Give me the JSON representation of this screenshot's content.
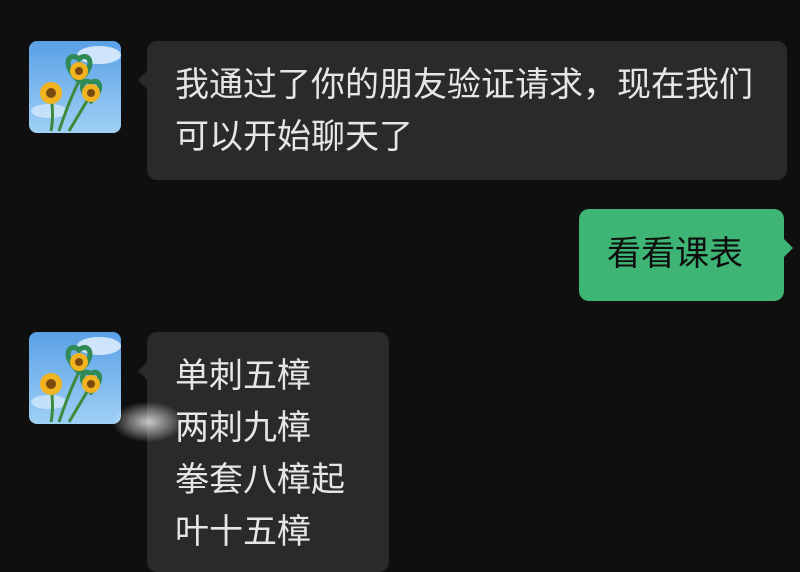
{
  "colors": {
    "background": "#0f0f0f",
    "incoming_bubble": "#2a2a2a",
    "outgoing_bubble": "#3eb575",
    "incoming_text": "#e6e6e6",
    "outgoing_text": "#0e0e0e"
  },
  "messages": [
    {
      "direction": "incoming",
      "avatar": "sunflower-heart-avatar",
      "text": "我通过了你的朋友验证请求，现在我们可以开始聊天了"
    },
    {
      "direction": "outgoing",
      "text": "看看课表"
    },
    {
      "direction": "incoming",
      "avatar": "sunflower-heart-avatar",
      "lines": [
        "单刺五樟",
        "两刺九樟",
        "拳套八樟起",
        "叶十五樟"
      ]
    }
  ]
}
